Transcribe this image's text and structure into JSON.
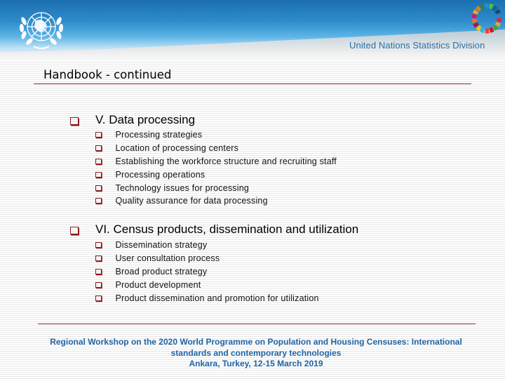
{
  "header": {
    "logo": "un-emblem-icon",
    "sdg_logo": "sdg-wheel-icon",
    "organization": "United Nations Statistics Division"
  },
  "slide": {
    "title": "Handbook - continued",
    "sections": [
      {
        "label": "V. Data processing",
        "items": [
          "Processing strategies",
          "Location of processing centers",
          "Establishing the workforce structure and recruiting staff",
          "Processing operations",
          "Technology issues for processing",
          "Quality assurance for data processing"
        ]
      },
      {
        "label": "VI. Census products, dissemination and utilization",
        "items": [
          "Dissemination strategy",
          "User consultation process",
          "Broad product strategy",
          "Product development",
          "Product dissemination and promotion for utilization"
        ]
      }
    ]
  },
  "footer": {
    "line1": "Regional Workshop on the 2020 World Programme on Population and Housing Censuses: International",
    "line2": "standards and contemporary technologies",
    "line3": "Ankara, Turkey, 12-15 March 2019"
  },
  "colors": {
    "accent_rule": "#7a1f1f",
    "bullet": "#8b1a1a",
    "footer_text": "#1f64a6",
    "org_text": "#2a6fa8"
  }
}
